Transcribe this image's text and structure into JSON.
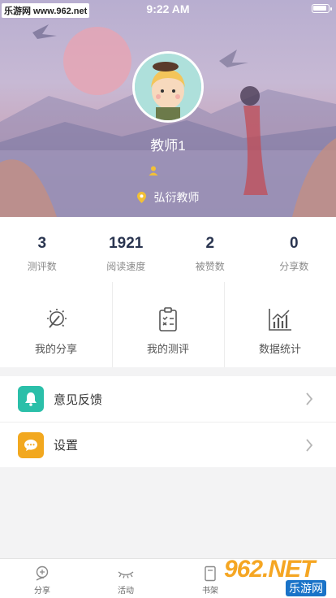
{
  "watermark_top": "乐游网 www.962.net",
  "status_bar": {
    "time": "9:22 AM"
  },
  "profile": {
    "name": "教师1",
    "school": "弘衍教师"
  },
  "stats": [
    {
      "value": "3",
      "label": "测评数"
    },
    {
      "value": "1921",
      "label": "阅读速度"
    },
    {
      "value": "2",
      "label": "被赞数"
    },
    {
      "value": "0",
      "label": "分享数"
    }
  ],
  "actions": [
    {
      "label": "我的分享",
      "icon": "bulb-pen-icon"
    },
    {
      "label": "我的测评",
      "icon": "clipboard-check-icon"
    },
    {
      "label": "数据统计",
      "icon": "bar-chart-icon"
    }
  ],
  "menu": [
    {
      "label": "意见反馈",
      "icon": "bell-icon",
      "color": "#2bbfa9"
    },
    {
      "label": "设置",
      "icon": "chat-bubble-icon",
      "color": "#f2a81f"
    }
  ],
  "tabbar": [
    {
      "label": "分享",
      "icon": "share-bubble-icon"
    },
    {
      "label": "活动",
      "icon": "eyelash-icon"
    },
    {
      "label": "书架",
      "icon": "book-icon"
    }
  ],
  "watermark_bottom": {
    "big": "962.NET",
    "small": "乐游网"
  }
}
